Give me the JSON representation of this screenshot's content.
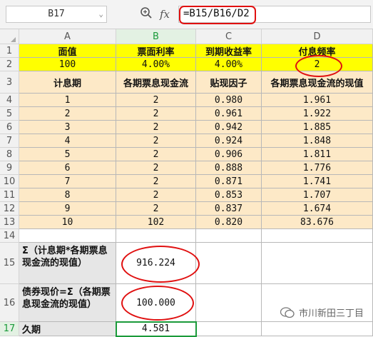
{
  "formula_bar": {
    "name_box": "B17",
    "fx_label": "fx",
    "formula": "=B15/B16/D2"
  },
  "columns": [
    "A",
    "B",
    "C",
    "D"
  ],
  "rows": [
    "1",
    "2",
    "3",
    "4",
    "5",
    "6",
    "7",
    "8",
    "9",
    "10",
    "11",
    "12",
    "13",
    "14",
    "15",
    "16",
    "17"
  ],
  "sheet": {
    "r1": [
      "面值",
      "票面利率",
      "到期收益率",
      "付息频率"
    ],
    "r2": [
      "100",
      "4.00%",
      "4.00%",
      "2"
    ],
    "r3": [
      "计息期",
      "各期票息现金流",
      "贴现因子",
      "各期票息现金流的现值"
    ],
    "table": [
      [
        "1",
        "2",
        "0.980",
        "1.961"
      ],
      [
        "2",
        "2",
        "0.961",
        "1.922"
      ],
      [
        "3",
        "2",
        "0.942",
        "1.885"
      ],
      [
        "4",
        "2",
        "0.924",
        "1.848"
      ],
      [
        "5",
        "2",
        "0.906",
        "1.811"
      ],
      [
        "6",
        "2",
        "0.888",
        "1.776"
      ],
      [
        "7",
        "2",
        "0.871",
        "1.741"
      ],
      [
        "8",
        "2",
        "0.853",
        "1.707"
      ],
      [
        "9",
        "2",
        "0.837",
        "1.674"
      ],
      [
        "10",
        "102",
        "0.820",
        "83.676"
      ]
    ],
    "r15": {
      "label": "Σ（计息期*各期票息现金流的现值）",
      "value": "916.224"
    },
    "r16": {
      "label": "债券现价=Σ（各期票息现金流的现值）",
      "value": "100.000"
    },
    "r17": {
      "label": "久期",
      "value": "4.581"
    }
  },
  "watermark": "市川新田三丁目",
  "colors": {
    "yellow": "#ffff00",
    "peach": "#fde9c7",
    "selected": "#1a9a3a",
    "annotation": "#e01010"
  }
}
